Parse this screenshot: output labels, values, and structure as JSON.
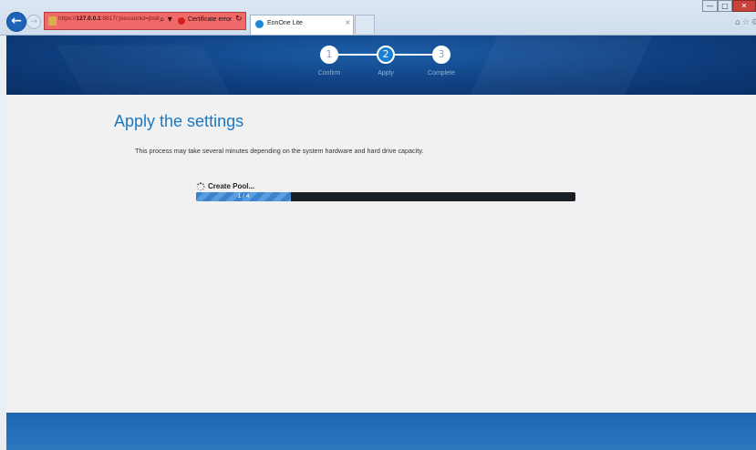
{
  "browser": {
    "back_icon": "back-arrow-icon",
    "forward_icon": "forward-arrow-icon",
    "address": {
      "url_prefix": "https://",
      "url_host": "127.0.0.1",
      "url_rest": ":8817/;jsessionid=jbs8",
      "search_glyph": "⌕ ▾",
      "certificate_error": "Certificate error",
      "refresh_glyph": "↻"
    },
    "tab": {
      "title": "EonOne Lite",
      "close": "×"
    },
    "window": {
      "minimize": "—",
      "maximize": "□",
      "close": "✕"
    },
    "tools": "⌂☆⚙"
  },
  "wizard": {
    "steps": [
      {
        "number": "1",
        "label": "Confirm",
        "state": "done"
      },
      {
        "number": "2",
        "label": "Apply",
        "state": "active"
      },
      {
        "number": "3",
        "label": "Complete",
        "state": "done"
      }
    ]
  },
  "main": {
    "heading": "Apply the settings",
    "description": "This process may take several minutes depending on the system hardware and hard drive capacity.",
    "task": {
      "icon": "spinner-icon",
      "label": "Create Pool...",
      "progress_text": "1 / 4",
      "progress_fraction": 0.25
    }
  },
  "colors": {
    "accent": "#1a78c2",
    "header_bg": "#0f3f80",
    "footer_bg": "#2d77bf",
    "progress_fill": "#3b82cf",
    "progress_track": "#1a1f26",
    "cert_error": "#f06a6a"
  }
}
